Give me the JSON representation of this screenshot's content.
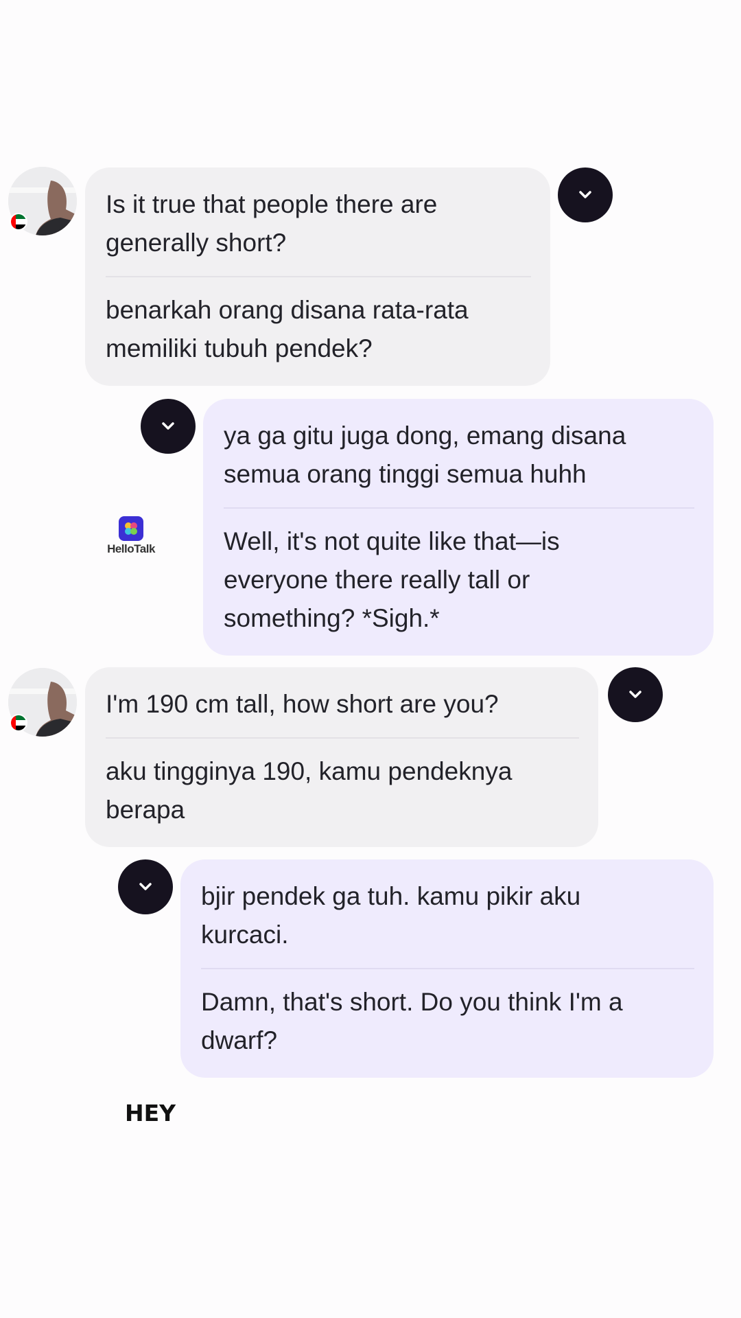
{
  "messages": [
    {
      "direction": "incoming",
      "original": "Is it true that people there are\ngenerally short?",
      "translation": "benarkah orang disana rata-rata\nmemiliki tubuh pendek?"
    },
    {
      "direction": "outgoing",
      "original": "ya ga gitu juga dong, emang disana\nsemua orang tinggi semua huhh",
      "translation": "Well, it's not quite like that—is\neveryone there really tall or\nsomething? *Sigh.*"
    },
    {
      "direction": "incoming",
      "original": "I'm 190 cm tall, how short are you?",
      "translation": "aku tingginya 190, kamu pendeknya\nberapa"
    },
    {
      "direction": "outgoing",
      "original": "bjir pendek ga tuh. kamu pikir aku\nkurcaci.",
      "translation": "Damn, that's short. Do you think I'm a\ndwarf?"
    }
  ],
  "watermark": {
    "brand": "HelloTalk",
    "tile_color": "#3c2fd4"
  },
  "caption": "HEY",
  "icons": {
    "expand": "chevron-down-icon",
    "avatar": "user-avatar",
    "flag": "uae-flag-icon"
  },
  "colors": {
    "incoming_bubble": "#f1f0f2",
    "outgoing_bubble": "#efebfd",
    "chevron_button": "#16121f",
    "text": "#222229"
  }
}
